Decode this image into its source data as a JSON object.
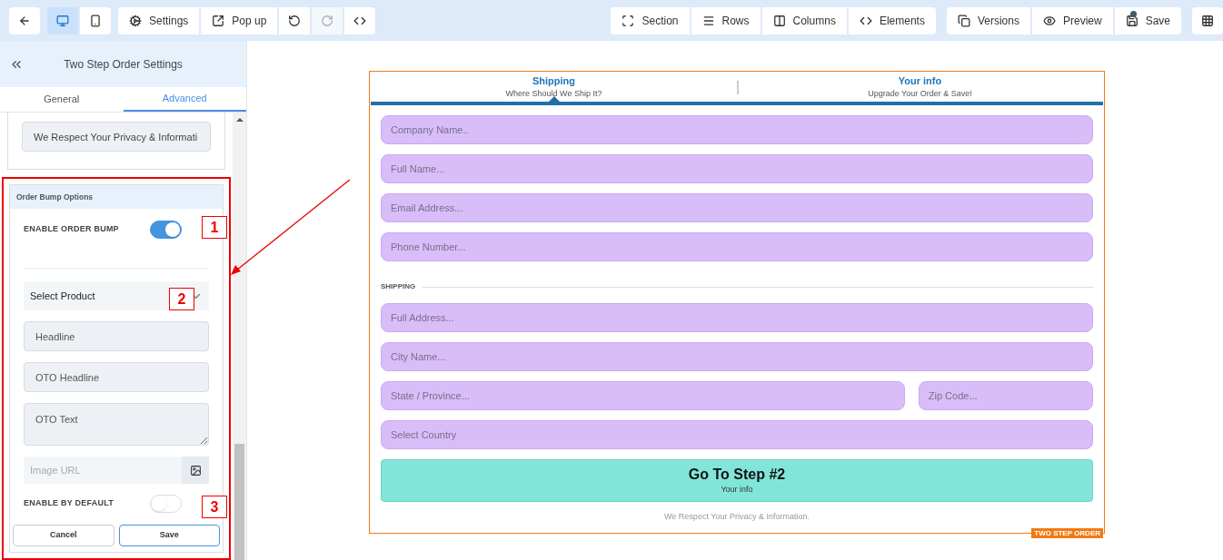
{
  "toolbar": {
    "left_groups": [
      {
        "items": [
          {
            "selected": false,
            "disabled": false
          }
        ]
      },
      {
        "items": [
          {
            "selected": true,
            "disabled": false
          },
          {
            "selected": false,
            "disabled": false
          }
        ]
      },
      {
        "items": [
          {
            "label": "Settings",
            "selected": false,
            "disabled": false
          },
          {
            "label": "Pop up",
            "selected": false,
            "disabled": false
          },
          {
            "selected": false,
            "disabled": false
          },
          {
            "selected": false,
            "disabled": true
          },
          {
            "selected": false,
            "disabled": false
          }
        ]
      }
    ],
    "right_groups": [
      {
        "items": [
          {
            "label": "Section"
          },
          {
            "label": "Rows"
          },
          {
            "label": "Columns"
          },
          {
            "label": "Elements"
          }
        ]
      },
      {
        "items": [
          {
            "label": "Versions"
          },
          {
            "label": "Preview"
          },
          {
            "label": "Save",
            "unsaved": true
          }
        ]
      }
    ]
  },
  "sidebar": {
    "title": "Two Step Order Settings",
    "tabs": [
      {
        "label": "General",
        "selected": false
      },
      {
        "label": "Advanced",
        "selected": true
      }
    ],
    "footer_field": {
      "value": "We Respect Your Privacy & Informati"
    },
    "order_bump": {
      "title": "Order Bump Options",
      "enable_toggle": {
        "label": "ENABLE ORDER BUMP",
        "on": true
      },
      "product_select": {
        "value": "Select Product"
      },
      "fields": [
        {
          "kind": "input",
          "placeholder": "Headline"
        },
        {
          "kind": "input",
          "placeholder": "OTO Headline"
        },
        {
          "kind": "textarea",
          "placeholder": "OTO Text"
        }
      ],
      "image_url": {
        "placeholder": "Image URL"
      },
      "default_toggle": {
        "label": "ENABLE BY DEFAULT",
        "on": false
      },
      "buttons": [
        {
          "label": "Cancel",
          "kind": "secondary"
        },
        {
          "label": "Save",
          "kind": "primary"
        }
      ]
    }
  },
  "annotations": [
    "1",
    "2",
    "3"
  ],
  "form": {
    "steps": [
      {
        "title": "Shipping",
        "subtitle": "Where Should We Ship It?",
        "selected": true
      },
      {
        "title": "Your info",
        "subtitle": "Upgrade Your Order & Save!",
        "selected": false
      }
    ],
    "contact_rows": [
      [
        {
          "placeholder": "Company Name.."
        }
      ],
      [
        {
          "placeholder": "Full Name..."
        }
      ],
      [
        {
          "placeholder": "Email Address..."
        }
      ],
      [
        {
          "placeholder": "Phone Number..."
        }
      ]
    ],
    "section_label": "SHIPPING",
    "shipping_rows": [
      [
        {
          "placeholder": "Full Address..."
        }
      ],
      [
        {
          "placeholder": "City Name..."
        }
      ],
      [
        {
          "placeholder": "State / Province..."
        },
        {
          "placeholder": "Zip Code..."
        }
      ],
      [
        {
          "placeholder": "Select Country"
        }
      ]
    ],
    "submit": {
      "title": "Go To Step #2",
      "subtitle": "Your info"
    },
    "footer": "We Respect Your Privacy & Information.",
    "badge": "TWO STEP ORDER"
  }
}
